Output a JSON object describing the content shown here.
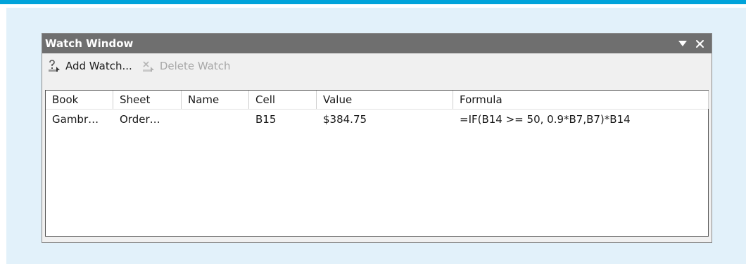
{
  "window": {
    "title": "Watch Window",
    "controls": {
      "dropdown_icon": "triangle-down-icon",
      "close_icon": "close-icon"
    }
  },
  "toolbar": {
    "add_watch": {
      "label": "Add Watch...",
      "icon": "add-watch-icon",
      "enabled": true
    },
    "delete_watch": {
      "label": "Delete Watch",
      "icon": "delete-watch-icon",
      "enabled": false
    }
  },
  "table": {
    "columns": [
      "Book",
      "Sheet",
      "Name",
      "Cell",
      "Value",
      "Formula"
    ],
    "rows": [
      {
        "book": "Gambr…",
        "sheet": "Order…",
        "name": "",
        "cell": "B15",
        "value": "$384.75",
        "formula": "=IF(B14 >= 50, 0.9*B7,B7)*B14"
      }
    ]
  },
  "colors": {
    "accent_rule": "#00a3da",
    "panel_background": "#e2f1fa",
    "titlebar": "#6f6f6f"
  }
}
